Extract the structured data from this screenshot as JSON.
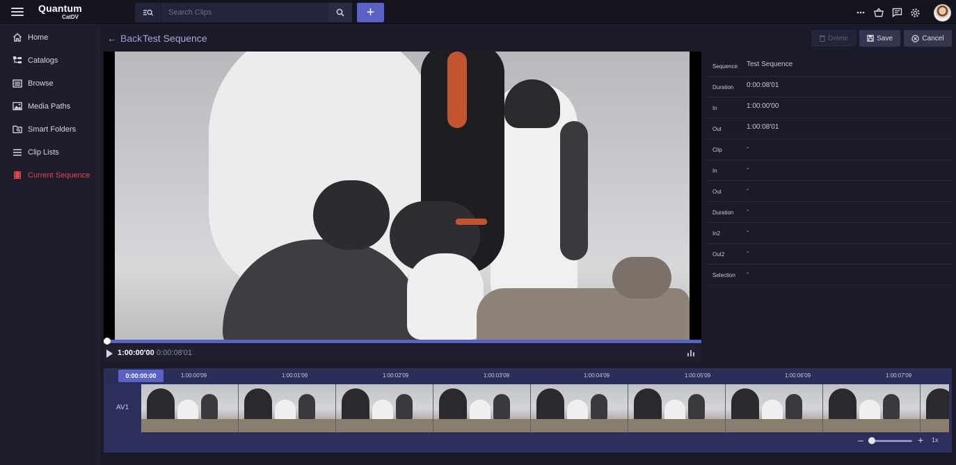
{
  "app": {
    "logo_main": "Quantum",
    "logo_sub": "CatDV"
  },
  "search": {
    "placeholder": "Search Clips"
  },
  "sidebar": {
    "items": [
      {
        "label": "Home",
        "icon": "home-icon"
      },
      {
        "label": "Catalogs",
        "icon": "catalogs-icon"
      },
      {
        "label": "Browse",
        "icon": "browse-icon"
      },
      {
        "label": "Media Paths",
        "icon": "media-paths-icon"
      },
      {
        "label": "Smart Folders",
        "icon": "smart-folders-icon"
      },
      {
        "label": "Clip Lists",
        "icon": "clip-lists-icon"
      },
      {
        "label": "Current Sequence",
        "icon": "current-sequence-icon",
        "active": true
      }
    ]
  },
  "header": {
    "back_label": "Back",
    "title": "Test Sequence",
    "delete_label": "Delete",
    "save_label": "Save",
    "cancel_label": "Cancel"
  },
  "player": {
    "current_tc": "1:00:00'00",
    "duration_tc": "0:00:08'01"
  },
  "metadata": [
    {
      "key": "Sequence",
      "value": "Test Sequence"
    },
    {
      "key": "Duration",
      "value": "0:00:08'01"
    },
    {
      "key": "In",
      "value": "1:00:00'00"
    },
    {
      "key": "Out",
      "value": "1:00:08'01"
    },
    {
      "key": "Clip",
      "value": "-"
    },
    {
      "key": "In",
      "value": "-"
    },
    {
      "key": "Out",
      "value": "-"
    },
    {
      "key": "Duration",
      "value": "-"
    },
    {
      "key": "In2",
      "value": "-"
    },
    {
      "key": "Out2",
      "value": "-"
    },
    {
      "key": "Selection",
      "value": "-"
    }
  ],
  "timeline": {
    "current_tc": "0:00:00:00",
    "ticks": [
      "1:00:00'09",
      "1:00:01'09",
      "1:00:02'09",
      "1:00:03'09",
      "1:00:04'09",
      "1:00:05'09",
      "1:00:06'09",
      "1:00:07'09"
    ],
    "track_label": "AV1",
    "zoom_value": "1x"
  },
  "colors": {
    "accent": "#5961c6",
    "active_nav": "#e0464b",
    "background": "#1a1a29"
  }
}
